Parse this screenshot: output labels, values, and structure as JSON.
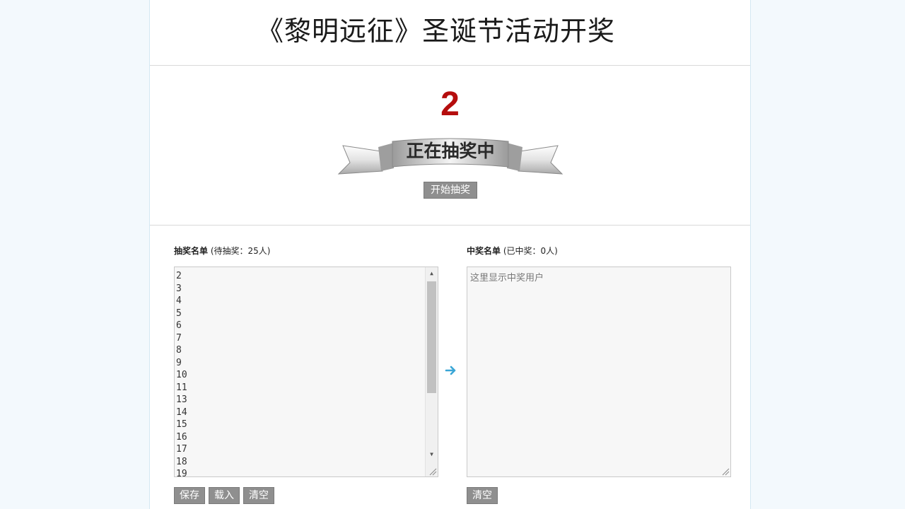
{
  "header": {
    "title": "《黎明远征》圣诞节活动开奖"
  },
  "draw": {
    "current_number": "2",
    "status_ribbon_text": "正在抽奖中",
    "start_button_label": "开始抽奖"
  },
  "candidates": {
    "label_bold": "抽奖名单",
    "label_count": "(待抽奖：25人)",
    "visible_entries": [
      "2",
      "3",
      "4",
      "5",
      "6",
      "7",
      "8",
      "9",
      "10",
      "11",
      "13",
      "14",
      "15",
      "16",
      "17",
      "18",
      "19"
    ],
    "buttons": {
      "save": "保存",
      "load": "载入",
      "clear": "清空"
    }
  },
  "winners": {
    "label_bold": "中奖名单",
    "label_count": "(已中奖：0人)",
    "placeholder": "这里显示中奖用户",
    "buttons": {
      "clear": "清空"
    }
  },
  "colors": {
    "page_background": "#f3f9fd",
    "number_red": "#b50d0d",
    "button_gray": "#8f8f8f",
    "arrow_blue": "#3aa6d6"
  },
  "icons": {
    "ribbon": "ribbon-banner-icon",
    "arrow": "arrow-right-icon",
    "scroll_up": "scroll-up-icon",
    "scroll_down": "scroll-down-icon",
    "resize": "resize-grip-icon"
  }
}
